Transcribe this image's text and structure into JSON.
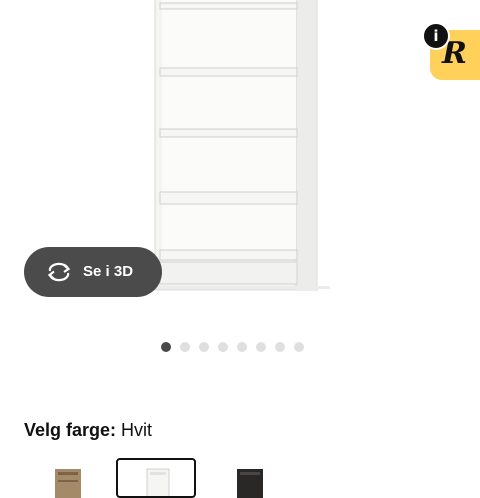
{
  "product": {
    "image_alt": "Bokhylle",
    "view_3d_label": "Se i 3D",
    "badge_letter": "R",
    "info_symbol": "i"
  },
  "carousel": {
    "total": 8,
    "active_index": 1
  },
  "color_selector": {
    "label": "Velg farge:",
    "value": "Hvit",
    "options": [
      {
        "name": "brown-oak",
        "swatch": "#a58a6a",
        "selected": false
      },
      {
        "name": "white",
        "swatch": "#f2f2f0",
        "selected": true
      },
      {
        "name": "black-brown",
        "swatch": "#2a2827",
        "selected": false
      }
    ]
  },
  "colors": {
    "button_bg": "#4b4b4b",
    "badge_bg": "#ffd05a",
    "dot_active": "#484848",
    "dot_inactive": "#dfdfdf"
  }
}
